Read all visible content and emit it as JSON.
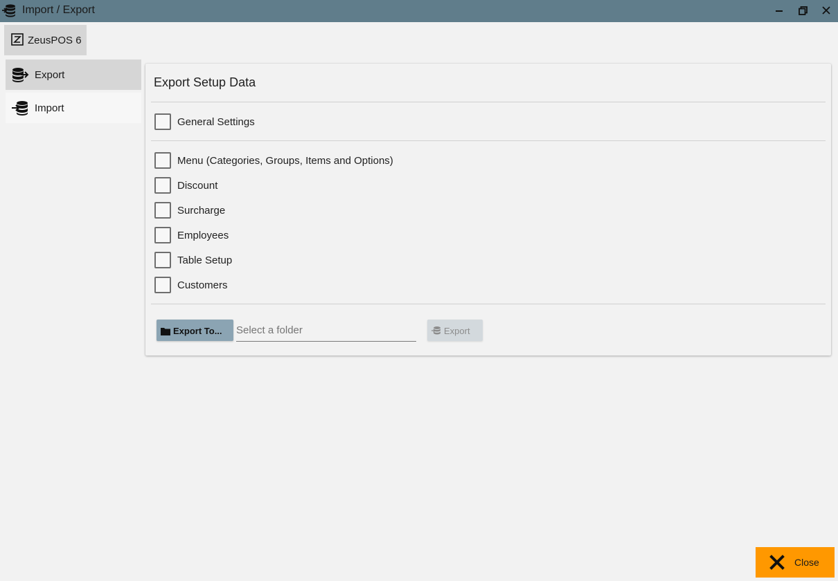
{
  "window": {
    "title": "Import / Export",
    "icon": "database-arrow-icon"
  },
  "app_tab": {
    "label": "ZeusPOS 6",
    "icon": "z-logo-icon"
  },
  "sidebar": {
    "items": [
      {
        "label": "Export",
        "icon": "database-export-icon",
        "selected": true
      },
      {
        "label": "Import",
        "icon": "database-import-icon",
        "selected": false
      }
    ]
  },
  "main": {
    "title": "Export Setup Data",
    "options": [
      {
        "label": "General Settings",
        "checked": false
      },
      {
        "label": "Menu (Categories, Groups, Items and Options)",
        "checked": false
      },
      {
        "label": "Discount",
        "checked": false
      },
      {
        "label": "Surcharge",
        "checked": false
      },
      {
        "label": "Employees",
        "checked": false
      },
      {
        "label": "Table Setup",
        "checked": false
      },
      {
        "label": "Customers",
        "checked": false
      }
    ],
    "export_to_label": "Export To...",
    "folder_placeholder": "Select a folder",
    "folder_value": "",
    "export_label": "Export"
  },
  "footer": {
    "close_label": "Close"
  },
  "colors": {
    "titlebar": "#607d8b",
    "accent_close": "#ff9800",
    "export_to_button": "#8ba4b3",
    "selected_item": "#d6d6d6"
  }
}
